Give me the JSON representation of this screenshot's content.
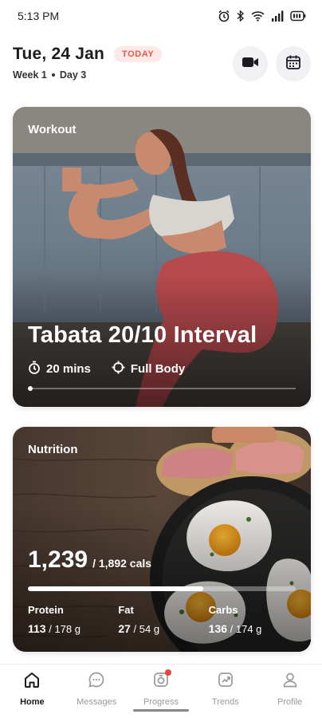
{
  "status_bar": {
    "time": "5:13 PM",
    "icons": [
      "alarm-icon",
      "bluetooth-icon",
      "wifi-icon",
      "signal-icon",
      "battery-icon"
    ]
  },
  "header": {
    "date": "Tue, 24 Jan",
    "badge": "TODAY",
    "week": "Week 1",
    "day": "Day 3",
    "buttons": [
      "video-camera-icon",
      "calendar-icon"
    ]
  },
  "workout": {
    "section_label": "Workout",
    "title": "Tabata 20/10 Interval",
    "duration": "20 mins",
    "focus": "Full Body"
  },
  "nutrition": {
    "section_label": "Nutrition",
    "calories_value": "1,239",
    "calories_total": "/ 1,892 cals",
    "calories_progress": 0.655,
    "macros": [
      {
        "name": "Protein",
        "value": "113",
        "total": "/ 178 g"
      },
      {
        "name": "Fat",
        "value": "27",
        "total": "/ 54 g"
      },
      {
        "name": "Carbs",
        "value": "136",
        "total": "/ 174 g"
      }
    ]
  },
  "nav": {
    "items": [
      {
        "label": "Home",
        "icon": "home-icon",
        "active": true
      },
      {
        "label": "Messages",
        "icon": "chat-icon",
        "active": false
      },
      {
        "label": "Progress",
        "icon": "progress-icon",
        "active": false
      },
      {
        "label": "Trends",
        "icon": "trends-icon",
        "active": false
      },
      {
        "label": "Profile",
        "icon": "profile-icon",
        "active": false
      }
    ]
  },
  "colors": {
    "accent": "#e8594a",
    "badge_bg": "#fde9e7",
    "notification": "#e8453c"
  }
}
